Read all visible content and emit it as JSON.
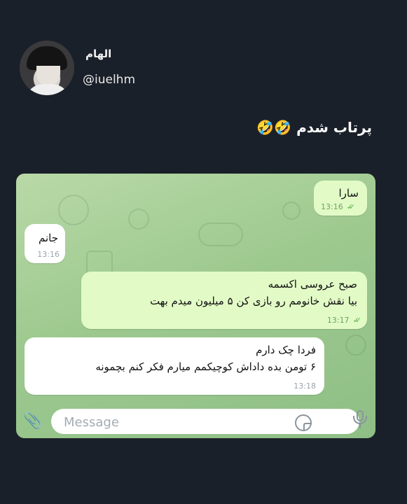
{
  "header": {
    "display_name": "الهام",
    "handle": "@iuelhm"
  },
  "post": {
    "text": "پرتاب شدم 🤣🤣"
  },
  "chat": {
    "messages": [
      {
        "direction": "out",
        "text_lines": [
          "سارا"
        ],
        "time": "13:16",
        "read": true
      },
      {
        "direction": "in",
        "text_lines": [
          "جانم"
        ],
        "time": "13:16"
      },
      {
        "direction": "out",
        "text_lines": [
          "صبح عروسی اکسمه",
          "بیا نقش خانومم رو بازی کن ۵ میلیون میدم بهت"
        ],
        "time": "13:17",
        "read": true
      },
      {
        "direction": "in",
        "text_lines": [
          "فردا چک دارم",
          "۶ تومن بده داداش کوچیکمم میارم فکر کنم بچمونه"
        ],
        "time": "13:18"
      }
    ],
    "input": {
      "placeholder": "Message"
    },
    "icons": {
      "attach": "paperclip-icon",
      "sticker": "sticker-icon",
      "voice": "microphone-icon"
    }
  }
}
